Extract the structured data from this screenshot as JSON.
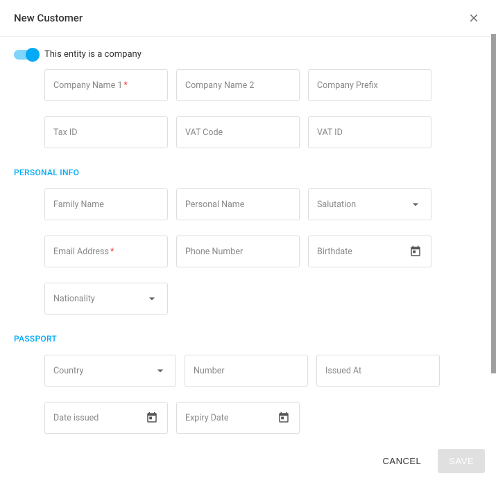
{
  "header": {
    "title": "New Customer"
  },
  "toggle": {
    "label": "This entity is a company",
    "checked": true
  },
  "company": {
    "name1": "Company Name 1",
    "name2": "Company Name 2",
    "prefix": "Company Prefix",
    "taxId": "Tax ID",
    "vatCode": "VAT Code",
    "vatId": "VAT ID"
  },
  "sections": {
    "personal": "PERSONAL INFO",
    "passport": "PASSPORT"
  },
  "personal": {
    "familyName": "Family Name",
    "personalName": "Personal Name",
    "salutation": "Salutation",
    "email": "Email Address",
    "phone": "Phone Number",
    "birthdate": "Birthdate",
    "nationality": "Nationality"
  },
  "passport": {
    "country": "Country",
    "number": "Number",
    "issuedAt": "Issued At",
    "dateIssued": "Date issued",
    "expiryDate": "Expiry Date"
  },
  "footer": {
    "cancel": "CANCEL",
    "save": "SAVE"
  },
  "required": "*"
}
